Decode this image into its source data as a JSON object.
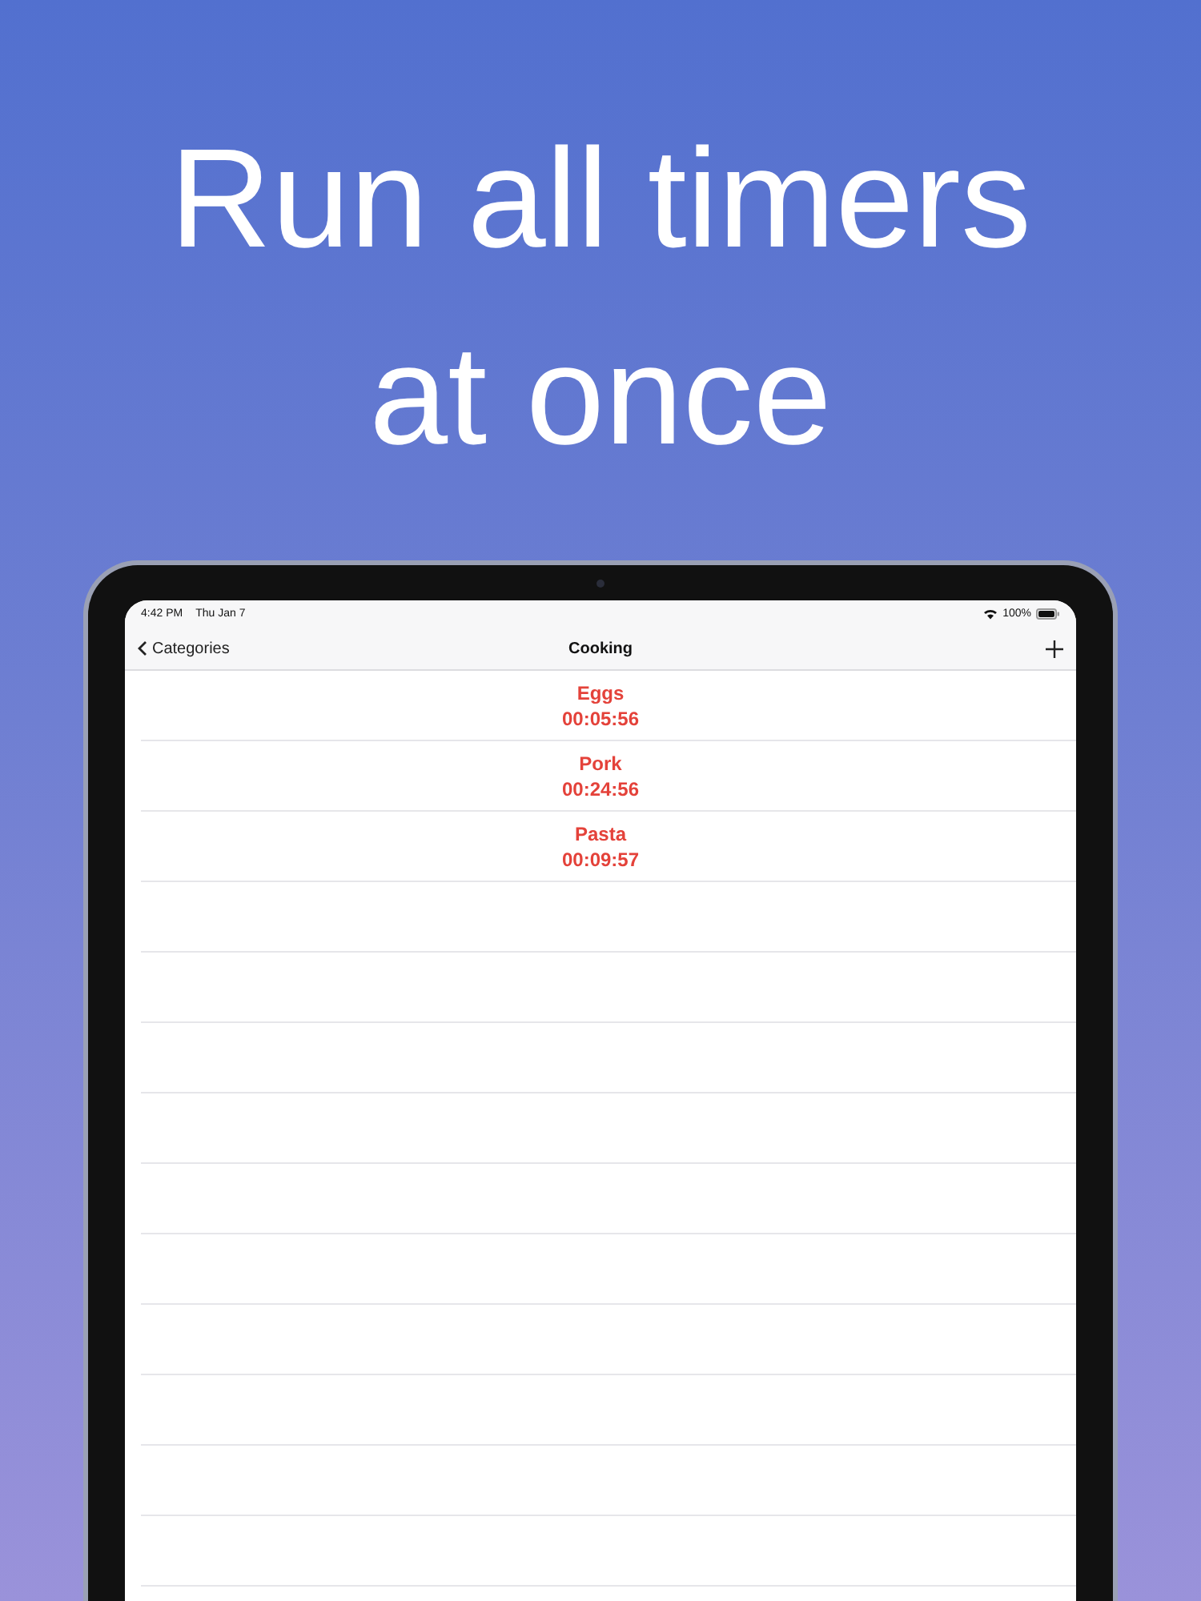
{
  "headline": "Run all timers at once",
  "status_bar": {
    "time": "4:42 PM",
    "date": "Thu Jan 7",
    "battery": "100%"
  },
  "nav_bar": {
    "back": "Categories",
    "title": "Cooking"
  },
  "timers": [
    {
      "name": "Eggs",
      "remaining": "00:05:56"
    },
    {
      "name": "Pork",
      "remaining": "00:24:56"
    },
    {
      "name": "Pasta",
      "remaining": "00:09:57"
    }
  ]
}
